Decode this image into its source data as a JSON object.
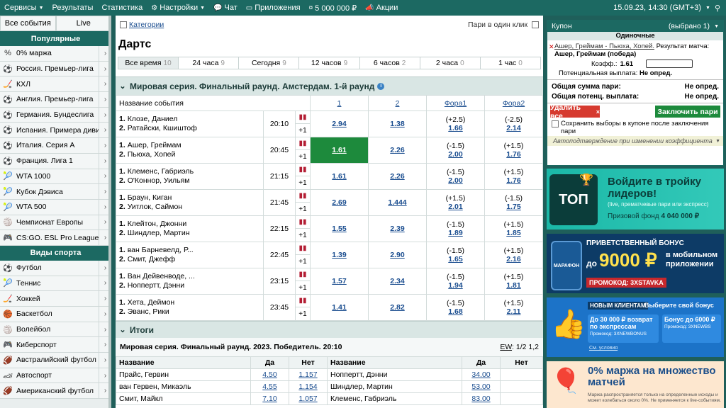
{
  "nav": {
    "items": [
      {
        "label": "Сервисы",
        "dd": true,
        "icon": ""
      },
      {
        "label": "Результаты",
        "dd": false,
        "icon": ""
      },
      {
        "label": "Статистика",
        "dd": false,
        "icon": ""
      },
      {
        "label": "Настройки",
        "dd": true,
        "icon": "gear-icon"
      },
      {
        "label": "Чат",
        "dd": false,
        "icon": "chat-icon"
      },
      {
        "label": "Приложения",
        "dd": false,
        "icon": "phone-icon"
      },
      {
        "label": "5 000 000 ₽",
        "dd": false,
        "icon": "coins-icon"
      },
      {
        "label": "Акции",
        "dd": false,
        "icon": "megaphone-icon"
      }
    ],
    "datetime": "15.09.23, 14:30 (GMT+3)"
  },
  "sidebar": {
    "tabs": [
      "Все события",
      "Live"
    ],
    "popular_title": "Популярные",
    "popular": [
      {
        "label": "0% маржа",
        "icon": "percent-icon"
      },
      {
        "label": "Россия. Премьер-лига",
        "icon": "soccer-ball-icon"
      },
      {
        "label": "КХЛ",
        "icon": "hockey-icon"
      },
      {
        "label": "Англия. Премьер-лига",
        "icon": "soccer-ball-icon"
      },
      {
        "label": "Германия. Бундеслига",
        "icon": "soccer-ball-icon"
      },
      {
        "label": "Испания. Примера дивиз...",
        "icon": "soccer-ball-icon"
      },
      {
        "label": "Италия. Серия А",
        "icon": "soccer-ball-icon"
      },
      {
        "label": "Франция. Лига 1",
        "icon": "soccer-ball-icon"
      },
      {
        "label": "WTA 1000",
        "icon": "tennis-icon"
      },
      {
        "label": "Кубок Дэвиса",
        "icon": "tennis-icon"
      },
      {
        "label": "WTA 500",
        "icon": "tennis-icon"
      },
      {
        "label": "Чемпионат Европы",
        "icon": "volleyball-icon"
      },
      {
        "label": "CS:GO. ESL Pro League",
        "icon": "gamepad-icon"
      }
    ],
    "sports_title": "Виды спорта",
    "sports": [
      {
        "label": "Футбол",
        "icon": "soccer-ball-icon"
      },
      {
        "label": "Теннис",
        "icon": "tennis-icon"
      },
      {
        "label": "Хоккей",
        "icon": "hockey-icon"
      },
      {
        "label": "Баскетбол",
        "icon": "basketball-icon"
      },
      {
        "label": "Волейбол",
        "icon": "volleyball-icon"
      },
      {
        "label": "Киберспорт",
        "icon": "gamepad-icon"
      },
      {
        "label": "Австралийский футбол",
        "icon": "rugby-ball-icon"
      },
      {
        "label": "Автоспорт",
        "icon": "car-icon"
      },
      {
        "label": "Американский футбол",
        "icon": "rugby-ball-icon"
      }
    ]
  },
  "main": {
    "categories_label": "Категории",
    "parlay_label": "Пари в один клик",
    "title": "Дартс",
    "time_filters": [
      {
        "label": "Все время",
        "count": "10"
      },
      {
        "label": "24 часа",
        "count": "9"
      },
      {
        "label": "Сегодня",
        "count": "9"
      },
      {
        "label": "12 часов",
        "count": "9"
      },
      {
        "label": "6 часов",
        "count": "2"
      },
      {
        "label": "2 часа",
        "count": "0"
      },
      {
        "label": "1 час",
        "count": "0"
      }
    ],
    "section_title": "Мировая серия. Финальный раунд. Амстердам. 1-й раунд",
    "columns": {
      "name": "Название события",
      "o1": "1",
      "o2": "2",
      "f1": "Фора1",
      "f2": "Фора2"
    },
    "events": [
      {
        "t1": "Клозе, Даниел",
        "t2": "Ратайски, Кшиштоф",
        "time": "20:10",
        "plus": "+1",
        "o1": "2.94",
        "o2": "1.38",
        "f1h": "(+2.5)",
        "f1": "1.66",
        "f2h": "(-2.5)",
        "f2": "2.14"
      },
      {
        "t1": "Ашер, Греймам",
        "t2": "Пьюха, Хопей",
        "time": "20:45",
        "plus": "+1",
        "o1": "1.61",
        "o2": "2.26",
        "f1h": "(-1.5)",
        "f1": "2.00",
        "f2h": "(+1.5)",
        "f2": "1.76"
      },
      {
        "t1": "Клеменс, Габриэль",
        "t2": "О'Коннор, Уильям",
        "time": "21:15",
        "plus": "+1",
        "o1": "1.61",
        "o2": "2.26",
        "f1h": "(-1.5)",
        "f1": "2.00",
        "f2h": "(+1.5)",
        "f2": "1.76"
      },
      {
        "t1": "Браун, Киган",
        "t2": "Уитлок, Саймон",
        "time": "21:45",
        "plus": "+1",
        "o1": "2.69",
        "o2": "1.444",
        "f1h": "(+1.5)",
        "f1": "2.01",
        "f2h": "(-1.5)",
        "f2": "1.75"
      },
      {
        "t1": "Клейтон, Джонни",
        "t2": "Шиндлер, Мартин",
        "time": "22:15",
        "plus": "+1",
        "o1": "1.55",
        "o2": "2.39",
        "f1h": "(-1.5)",
        "f1": "1.89",
        "f2h": "(+1.5)",
        "f2": "1.85"
      },
      {
        "t1": "ван Барневелд, Р...",
        "t2": "Смит, Джефф",
        "time": "22:45",
        "plus": "+1",
        "o1": "1.39",
        "o2": "2.90",
        "f1h": "(-1.5)",
        "f1": "1.65",
        "f2h": "(+1.5)",
        "f2": "2.16"
      },
      {
        "t1": "Ван Дейвенводе, ...",
        "t2": "Ноппертт, Дэнни",
        "time": "23:15",
        "plus": "+1",
        "o1": "1.57",
        "o2": "2.34",
        "f1h": "(-1.5)",
        "f1": "1.94",
        "f2h": "(+1.5)",
        "f2": "1.81"
      },
      {
        "t1": "Хета, Деймон",
        "t2": "Эванс, Рики",
        "time": "23:45",
        "plus": "+1",
        "o1": "1.41",
        "o2": "2.82",
        "f1h": "(-1.5)",
        "f1": "1.68",
        "f2h": "(+1.5)",
        "f2": "2.11"
      }
    ],
    "itogi_title": "Итоги",
    "itogi_sub": "Мировая серия. Финальный раунд. 2023. Победитель.  20:10",
    "itogi_ew_label": "EW",
    "itogi_ew_value": ": 1/2 1,2",
    "itogi_cols": {
      "name": "Название",
      "yes": "Да",
      "no": "Нет"
    },
    "itogi_rows": [
      {
        "n1": "Прайс, Гервин",
        "y1": "4.50",
        "no1": "1.157",
        "n2": "Ноппертт, Дэнни",
        "y2": "34.00",
        "no2": ""
      },
      {
        "n1": "ван Гервен, Микаэль",
        "y1": "4.55",
        "no1": "1.154",
        "n2": "Шиндлер, Мартин",
        "y2": "53.00",
        "no2": ""
      },
      {
        "n1": "Смит, Майкл",
        "y1": "7.10",
        "no1": "1.057",
        "n2": "Клеменс, Габриэль",
        "y2": "83.00",
        "no2": ""
      }
    ]
  },
  "coupon": {
    "title": "Купон",
    "selected": "(выбрано 1)",
    "sub": "Одиночные",
    "event": "Ашер, Греймам - Пьюха, Хопей.",
    "result_label": "Результат матча:",
    "pick": "Ашер, Греймам (победа)",
    "coef_label": "Коэфф.:",
    "coef": "1.61",
    "potential_label": "Потенциальная выплата:",
    "potential_value": "Не опред.",
    "total_label": "Общая сумма пари:",
    "total_value": "Не опред.",
    "total_pot_label": "Общая потенц. выплата:",
    "total_pot_value": "Не опред.",
    "delete_all": "Удалить все",
    "place_bet": "Заключить пари",
    "save_label": "Сохранить выборы в купоне после заключения пари",
    "auto_confirm": "Автоподтверждение при изменении коэффициента"
  },
  "banners": {
    "b1_text": "Войдите в тройку лидеров!",
    "b1_sub": "(live, прематчевые пари или экспресс)",
    "b1_fund": "Призовой фонд",
    "b1_amount": "4 040 000 ₽",
    "b1_logo": "ТОП",
    "b2_top": "ПРИВЕТСТВЕННЫЙ БОНУС",
    "b2_do": "до",
    "b2_amount": "9000 ₽",
    "b2_side": "в мобильном приложении",
    "b2_promo": "ПРОМОКОД: 3XSTAVKA",
    "b2_brand": "МАРАФОН",
    "b3_new": "НОВЫМ КЛИЕНТАМ",
    "b3_choose": "Выберите свой бонус",
    "b3_left": "До 30 000 ₽ возврат по экспрессам",
    "b3_left_promo": "Промокод: 3XNEWBONUS",
    "b3_right": "Бонус до 6000 ₽",
    "b3_right_promo": "Промокод: 3XNEWBS",
    "b3_terms": "См. условия",
    "b4_title": "0% маржа на множество матчей",
    "b4_sub": "Маржа распространяется только на определенные исходы и может колебаться около 0%. Не применяется к live-событиям."
  }
}
